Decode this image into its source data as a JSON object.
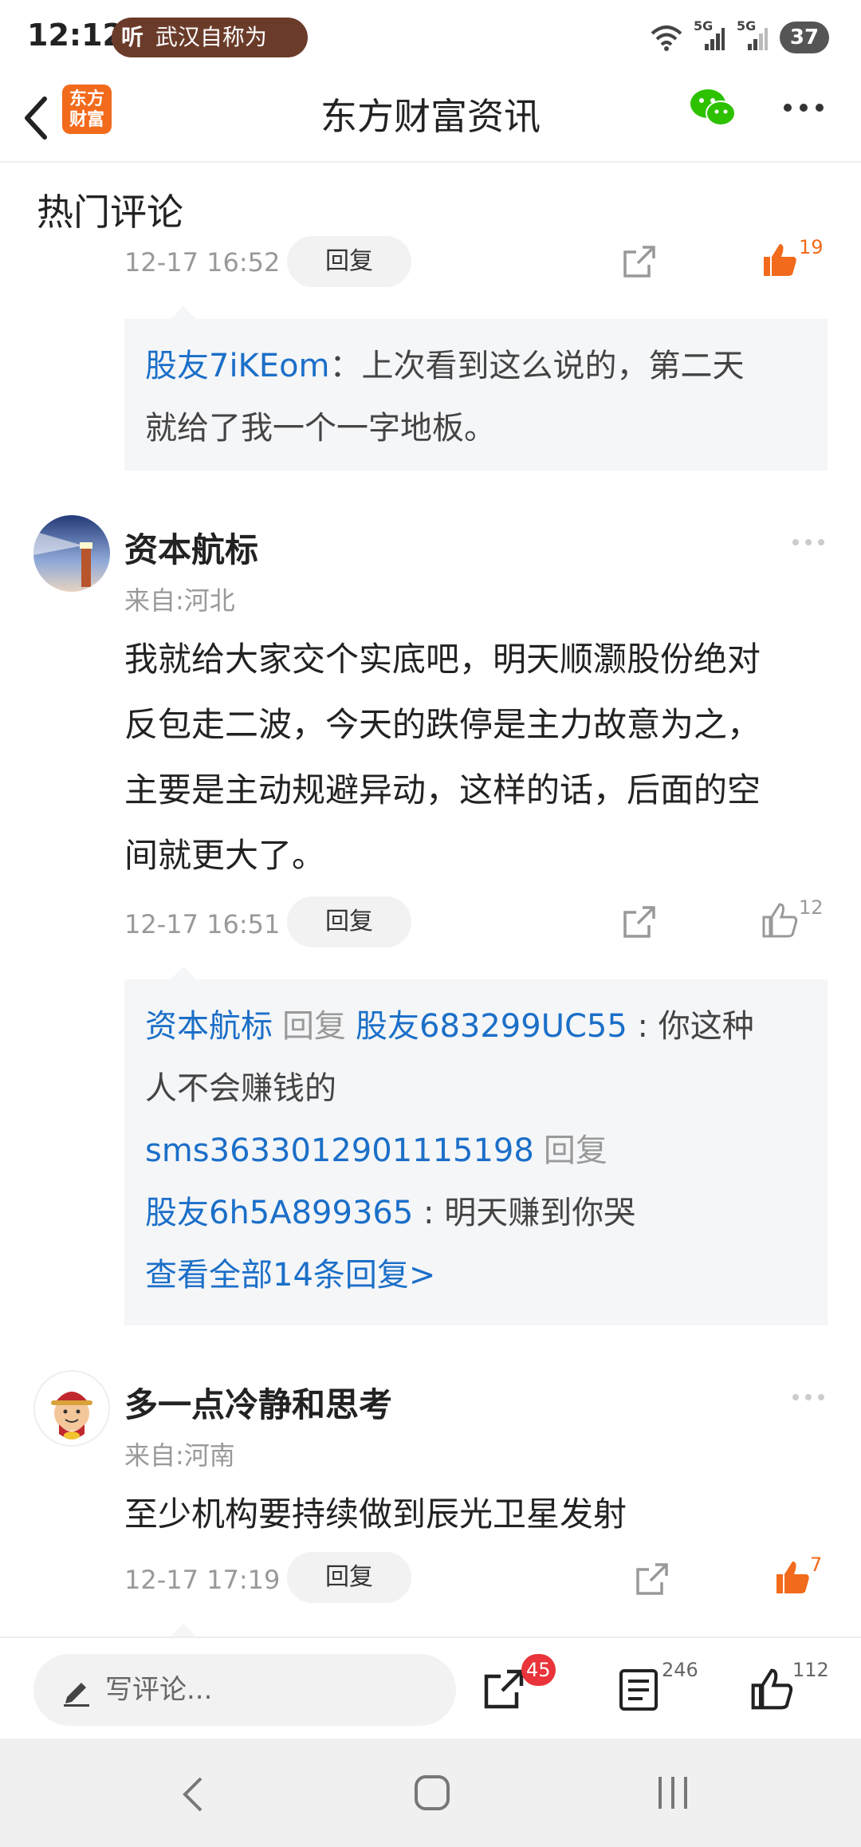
{
  "status_bar": {
    "time": "12:12",
    "listen_icon": "听",
    "listen_text": "武汉自称为",
    "battery": "37",
    "signal_label_1": "5G",
    "signal_label_2": "5G"
  },
  "header": {
    "logo_text_1": "东方",
    "logo_text_2": "财富",
    "title": "东方财富资讯"
  },
  "section_title": "热门评论",
  "comments": [
    {
      "time": "12-17 16:52",
      "reply_label": "回复",
      "likes": "19",
      "liked": true,
      "replies": [
        {
          "user": "股友7iKEom",
          "text": "：上次看到这么说的，第二天",
          "text2": "就给了我一个一字地板。"
        }
      ]
    },
    {
      "author": "资本航标",
      "region": "来自:河北",
      "body": [
        "我就给大家交个实底吧，明天顺灏股份绝对",
        "反包走二波，今天的跌停是主力故意为之，",
        "主要是主动规避异动，这样的话，后面的空",
        "间就更大了。"
      ],
      "time": "12-17 16:51",
      "reply_label": "回复",
      "likes": "12",
      "liked": false,
      "replies": [
        {
          "user": "资本航标",
          "reply_word": "回复",
          "target": "股友683299UC55",
          "text": " : 你这种",
          "text2": "人不会赚钱的"
        },
        {
          "user": "sms3633012901115198",
          "reply_word": "回复",
          "target": "股友6h5A899365",
          "text": " : 明天赚到你哭"
        }
      ],
      "view_all": "查看全部14条回复>"
    },
    {
      "author": "多一点冷静和思考",
      "region": "来自:河南",
      "body": [
        "至少机构要持续做到辰光卫星发射"
      ],
      "time": "12-17 17:19",
      "reply_label": "回复",
      "likes": "7",
      "liked": true
    }
  ],
  "bottom_bar": {
    "placeholder": "写评论...",
    "share_badge": "45",
    "comments_count": "246",
    "likes_count": "112"
  },
  "colors": {
    "brand": "#f26a1b",
    "link": "#1b6fc8",
    "badge": "#e8343a",
    "muted": "#999999"
  },
  "icons": [
    "back-icon",
    "wechat-icon",
    "more-icon",
    "share-icon",
    "like-icon",
    "pen-icon",
    "comment-list-icon",
    "nav-back-icon",
    "nav-home-icon",
    "nav-recents-icon"
  ]
}
